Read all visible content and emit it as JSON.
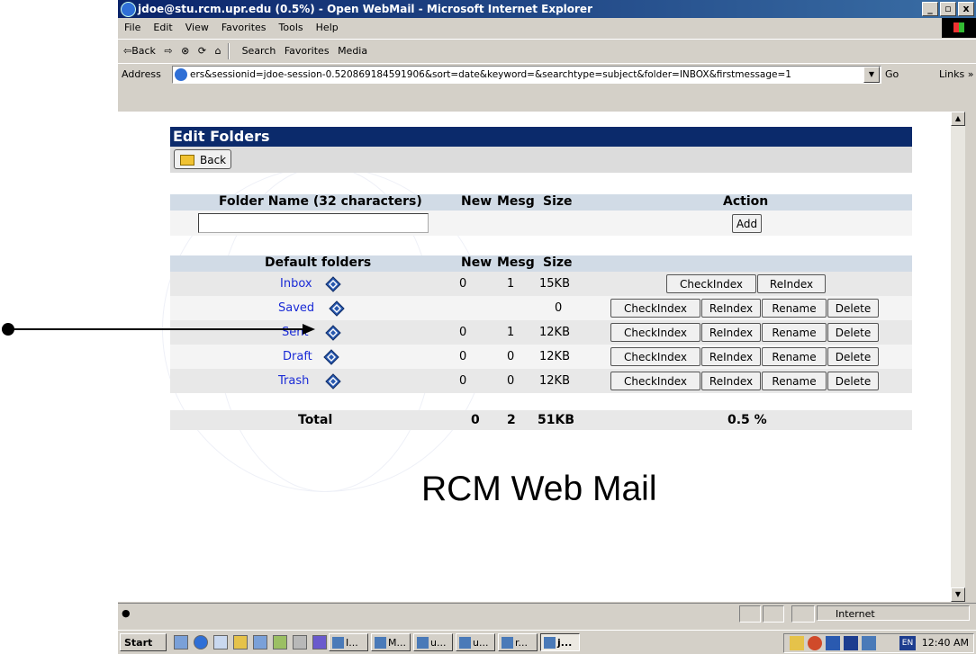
{
  "window": {
    "title": "jdoe@stu.rcm.upr.edu (0.5%) - Open WebMail - Microsoft Internet Explorer",
    "controls": [
      "_",
      "▫",
      "x"
    ]
  },
  "menu": [
    "File",
    "Edit",
    "View",
    "Favorites",
    "Tools",
    "Help"
  ],
  "toolbar": {
    "back": "⇦Back",
    "forward": "⇨",
    "stop": "⊗",
    "refresh": "⟳",
    "home": "⌂",
    "search": "Search",
    "favorites": "Favorites",
    "media": "Media"
  },
  "address": {
    "label": "Address",
    "url": "ers&sessionid=jdoe-session-0.520869184591906&sort=date&keyword=&searchtype=subject&folder=INBOX&firstmessage=1",
    "go": "Go",
    "links": "Links »"
  },
  "page": {
    "section_title": "Edit Folders",
    "back_label": "Back",
    "new_folder": {
      "headers": [
        "Folder Name (32 characters)",
        "New",
        "Mesg",
        "Size",
        "Action"
      ],
      "add_label": "Add"
    },
    "default_folders": {
      "headers": [
        "Default folders",
        "New",
        "Mesg",
        "Size"
      ],
      "rows": [
        {
          "name": "Inbox",
          "new": "0",
          "mesg": "1",
          "size": "15KB"
        },
        {
          "name": "Saved",
          "new": "",
          "mesg": "",
          "size": "0"
        },
        {
          "name": "Sent",
          "new": "0",
          "mesg": "1",
          "size": "12KB"
        },
        {
          "name": "Draft",
          "new": "0",
          "mesg": "0",
          "size": "12KB"
        },
        {
          "name": "Trash",
          "new": "0",
          "mesg": "0",
          "size": "12KB"
        }
      ],
      "buttons": {
        "checkindex": "CheckIndex",
        "reindex": "ReIndex",
        "rename": "Rename",
        "delete": "Delete"
      }
    },
    "total": {
      "label": "Total",
      "new": "0",
      "mesg": "2",
      "size": "51KB",
      "quota": "0.5 %"
    },
    "brand": "RCM Web Mail"
  },
  "status": {
    "zone": "Internet"
  },
  "taskbar": {
    "start": "Start",
    "tasks": [
      "I...",
      "M...",
      "u...",
      "u...",
      "r...",
      "j..."
    ],
    "lang": "EN",
    "clock": "12:40 AM"
  }
}
